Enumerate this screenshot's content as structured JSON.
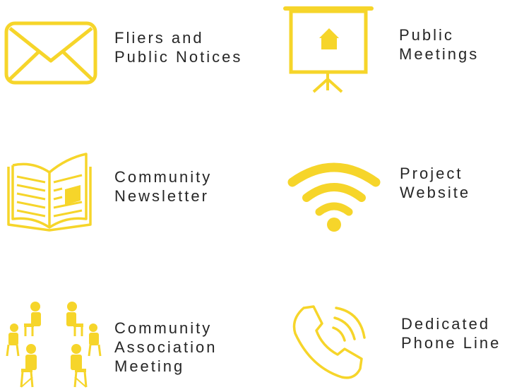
{
  "accent_color": "#f6d52a",
  "items": [
    {
      "icon": "envelope-icon",
      "lines": [
        "Fliers and",
        "Public Notices"
      ]
    },
    {
      "icon": "presentation-board-icon",
      "lines": [
        "Public",
        "Meetings"
      ]
    },
    {
      "icon": "open-book-icon",
      "lines": [
        "Community",
        "Newsletter"
      ]
    },
    {
      "icon": "wifi-icon",
      "lines": [
        "Project",
        "Website"
      ]
    },
    {
      "icon": "people-circle-icon",
      "lines": [
        "Community",
        "Association",
        "Meeting"
      ]
    },
    {
      "icon": "phone-icon",
      "lines": [
        "Dedicated",
        "Phone Line"
      ]
    }
  ]
}
